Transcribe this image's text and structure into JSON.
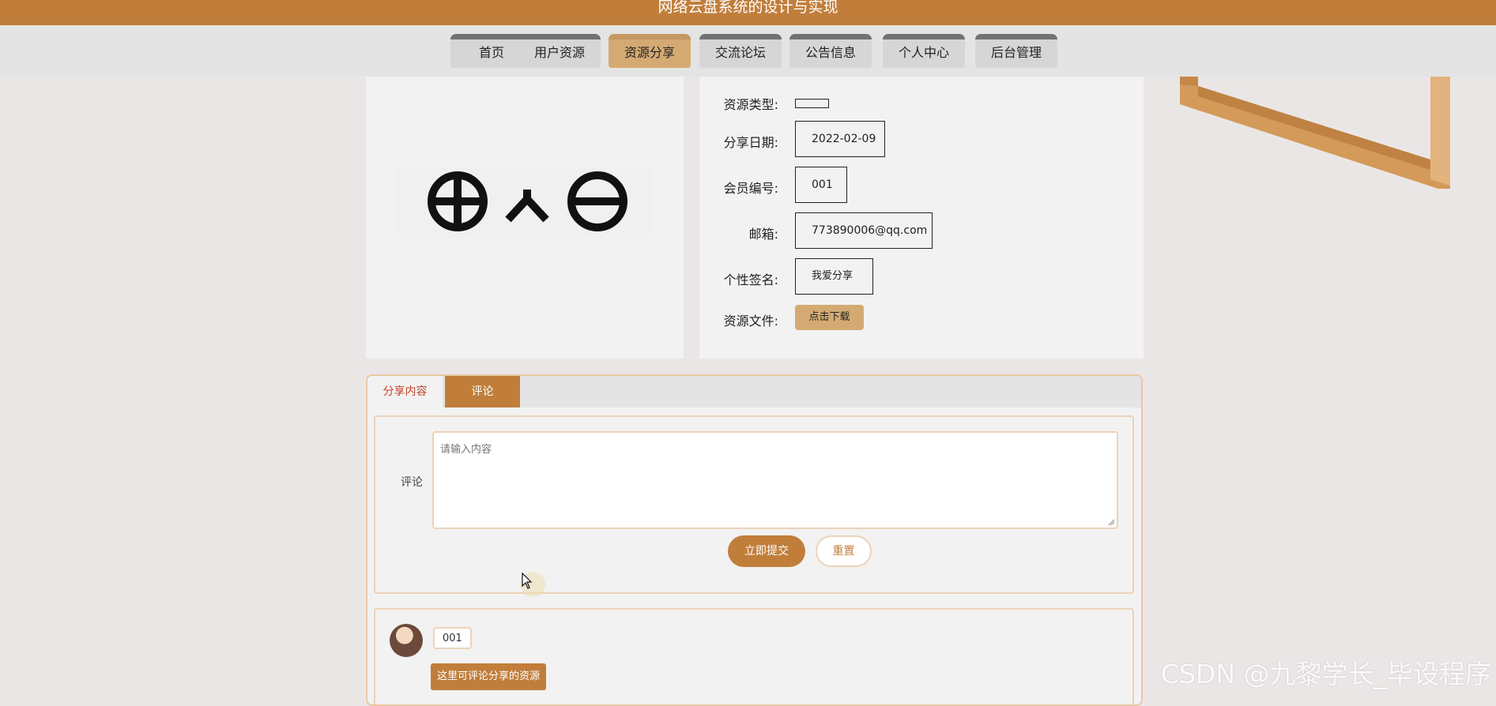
{
  "header": {
    "title": "网络云盘系统的设计与实现"
  },
  "nav": {
    "items": [
      {
        "label": "首页"
      },
      {
        "label": "用户资源"
      },
      {
        "label": "资源分享"
      },
      {
        "label": "交流论坛"
      },
      {
        "label": "公告信息"
      },
      {
        "label": "个人中心"
      },
      {
        "label": "后台管理"
      }
    ],
    "active": "资源分享"
  },
  "resource": {
    "type_label": "资源类型:",
    "type_value": "",
    "date_label": "分享日期:",
    "date_value": "2022-02-09",
    "member_label": "会员编号:",
    "member_value": "001",
    "email_label": "邮箱:",
    "email_value": "773890006@qq.com",
    "signature_label": "个性签名:",
    "signature_value": "我爱分享",
    "file_label": "资源文件:",
    "download_label": "点击下载"
  },
  "tabs": [
    {
      "label": "分享内容"
    },
    {
      "label": "评论"
    }
  ],
  "comment_form": {
    "label": "评论",
    "placeholder": "请输入内容",
    "submit_label": "立即提交",
    "reset_label": "重置"
  },
  "comments": [
    {
      "user": "001",
      "text": "这里可评论分享的资源"
    }
  ],
  "watermark": "CSDN @九黎学长_毕设程序",
  "colors": {
    "brand": "#c17e3b",
    "nav_active": "#d4aa72",
    "tab_active_text": "#c2442a"
  }
}
